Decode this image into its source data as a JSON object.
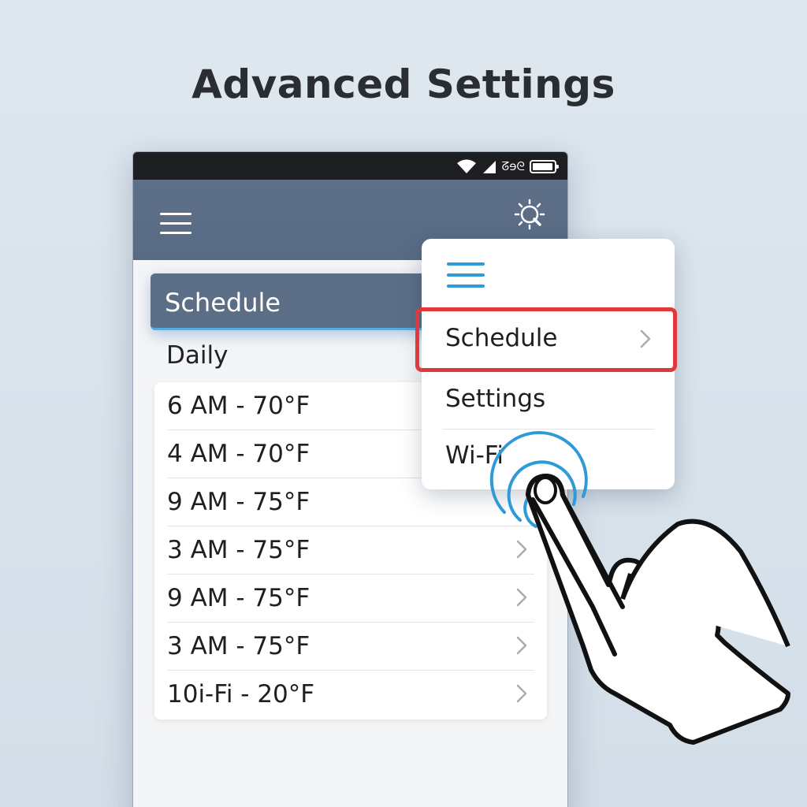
{
  "headline": "Advanced Settings",
  "status_bar": {
    "time": "ᘔɘᘓ",
    "icons": [
      "wifi-icon",
      "signal-icon",
      "battery-icon"
    ]
  },
  "app_bar": {
    "menu_icon": "hamburger-icon",
    "action_icon": "sun-search-icon"
  },
  "schedule_tab": {
    "label": "Schedule"
  },
  "section_label": "Daily",
  "schedule_items": [
    {
      "label": "6 AM - 70°F"
    },
    {
      "label": "4 AM - 70°F"
    },
    {
      "label": "9 AM - 75°F"
    },
    {
      "label": "3 AM - 75°F"
    },
    {
      "label": "9 AM - 75°F"
    },
    {
      "label": "3 AM - 75°F"
    },
    {
      "label": "10i-Fi - 20°F"
    }
  ],
  "popup_menu": {
    "menu_icon": "hamburger-icon",
    "items": [
      {
        "label": "Schedule",
        "highlighted": true
      },
      {
        "label": "Settings"
      },
      {
        "label": "Wi-Fi"
      }
    ]
  },
  "colors": {
    "app_bar": "#5e7088",
    "accent_blue": "#2e9ad8",
    "highlight_red": "#e0393b",
    "background": "#d8e2ec"
  }
}
